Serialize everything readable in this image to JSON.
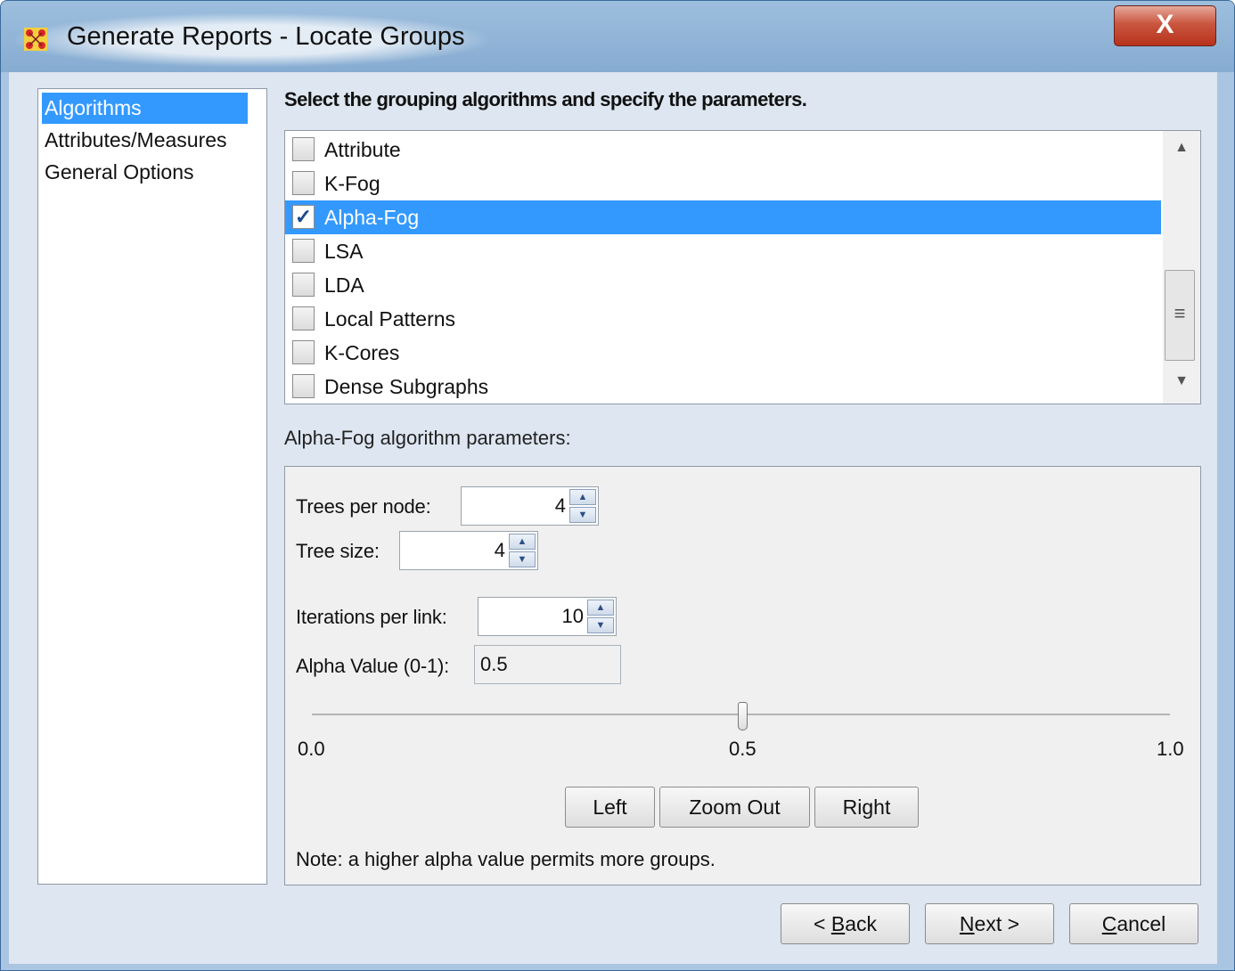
{
  "window": {
    "title": "Generate Reports - Locate Groups",
    "close_label": "X"
  },
  "sidebar": {
    "items": [
      {
        "label": "Algorithms",
        "selected": true
      },
      {
        "label": "Attributes/Measures",
        "selected": false
      },
      {
        "label": "General Options",
        "selected": false
      }
    ]
  },
  "main": {
    "instruction": "Select the grouping algorithms and specify the parameters.",
    "algorithms": [
      {
        "label": "Attribute",
        "checked": false
      },
      {
        "label": "K-Fog",
        "checked": false
      },
      {
        "label": "Alpha-Fog",
        "checked": true
      },
      {
        "label": "LSA",
        "checked": false
      },
      {
        "label": "LDA",
        "checked": false
      },
      {
        "label": "Local Patterns",
        "checked": false
      },
      {
        "label": "K-Cores",
        "checked": false
      },
      {
        "label": "Dense Subgraphs",
        "checked": false
      }
    ],
    "params_title": "Alpha-Fog algorithm parameters:",
    "params": {
      "trees_per_node": {
        "label": "Trees per node:",
        "value": "4"
      },
      "tree_size": {
        "label": "Tree size:",
        "value": "4"
      },
      "iterations_per_link": {
        "label": "Iterations per link:",
        "value": "10"
      },
      "alpha_value": {
        "label": "Alpha Value (0-1):",
        "value": "0.5"
      }
    },
    "slider": {
      "min_label": "0.0",
      "mid_label": "0.5",
      "max_label": "1.0",
      "value": 0.5
    },
    "zoom_buttons": {
      "left": "Left",
      "zoom_out": "Zoom Out",
      "right": "Right"
    },
    "note": "Note: a higher alpha value permits more groups."
  },
  "footer": {
    "back_prefix": "< ",
    "back_mnemonic": "B",
    "back_rest": "ack",
    "next_mnemonic": "N",
    "next_rest": "ext >",
    "cancel_mnemonic": "C",
    "cancel_rest": "ancel"
  },
  "colors": {
    "selection": "#3399ff",
    "window_frame": "#a9c5e2",
    "close_button": "#c9563f"
  }
}
